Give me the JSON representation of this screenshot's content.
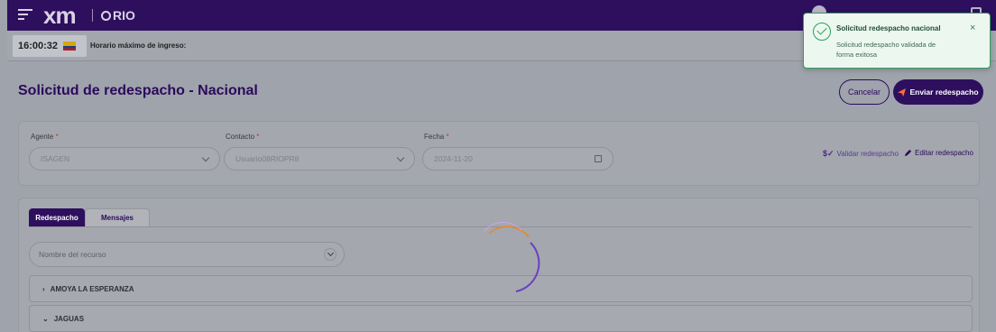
{
  "topbar": {
    "logo_text": "xm",
    "app_name": "RIO"
  },
  "timebar": {
    "time": "16:00:32",
    "horario_label": "Horario máximo de ingreso:"
  },
  "page": {
    "title": "Solicitud de redespacho - Nacional",
    "cancel_label": "Cancelar",
    "send_label": "Enviar redespacho"
  },
  "form": {
    "agente_label": "Agente",
    "agente_value": "ISAGEN",
    "contacto_label": "Contacto",
    "contacto_value": "Usuario08RIOPR8",
    "fecha_label": "Fecha",
    "fecha_value": "2024-11-20",
    "required_mark": "*",
    "validar_label": "Validar redespacho",
    "editar_label": "Editar redespacho"
  },
  "tabs": [
    {
      "label": "Redespacho",
      "active": true
    },
    {
      "label": "Mensajes",
      "active": false
    }
  ],
  "resource": {
    "placeholder": "Nombre del recurso"
  },
  "accordion": [
    {
      "label": "AMOYA LA ESPERANZA",
      "expanded": false
    },
    {
      "label": "JAGUAS",
      "expanded": true
    }
  ],
  "toast": {
    "title": "Solicitud redespacho nacional",
    "message": "Solicitud redespacho validada de forma exitosa",
    "close_glyph": "×"
  },
  "colors": {
    "brand": "#2e0f5e",
    "success": "#2f9e5a",
    "spinner_orange": "#e8862a",
    "spinner_purple": "#6a3fc4"
  }
}
